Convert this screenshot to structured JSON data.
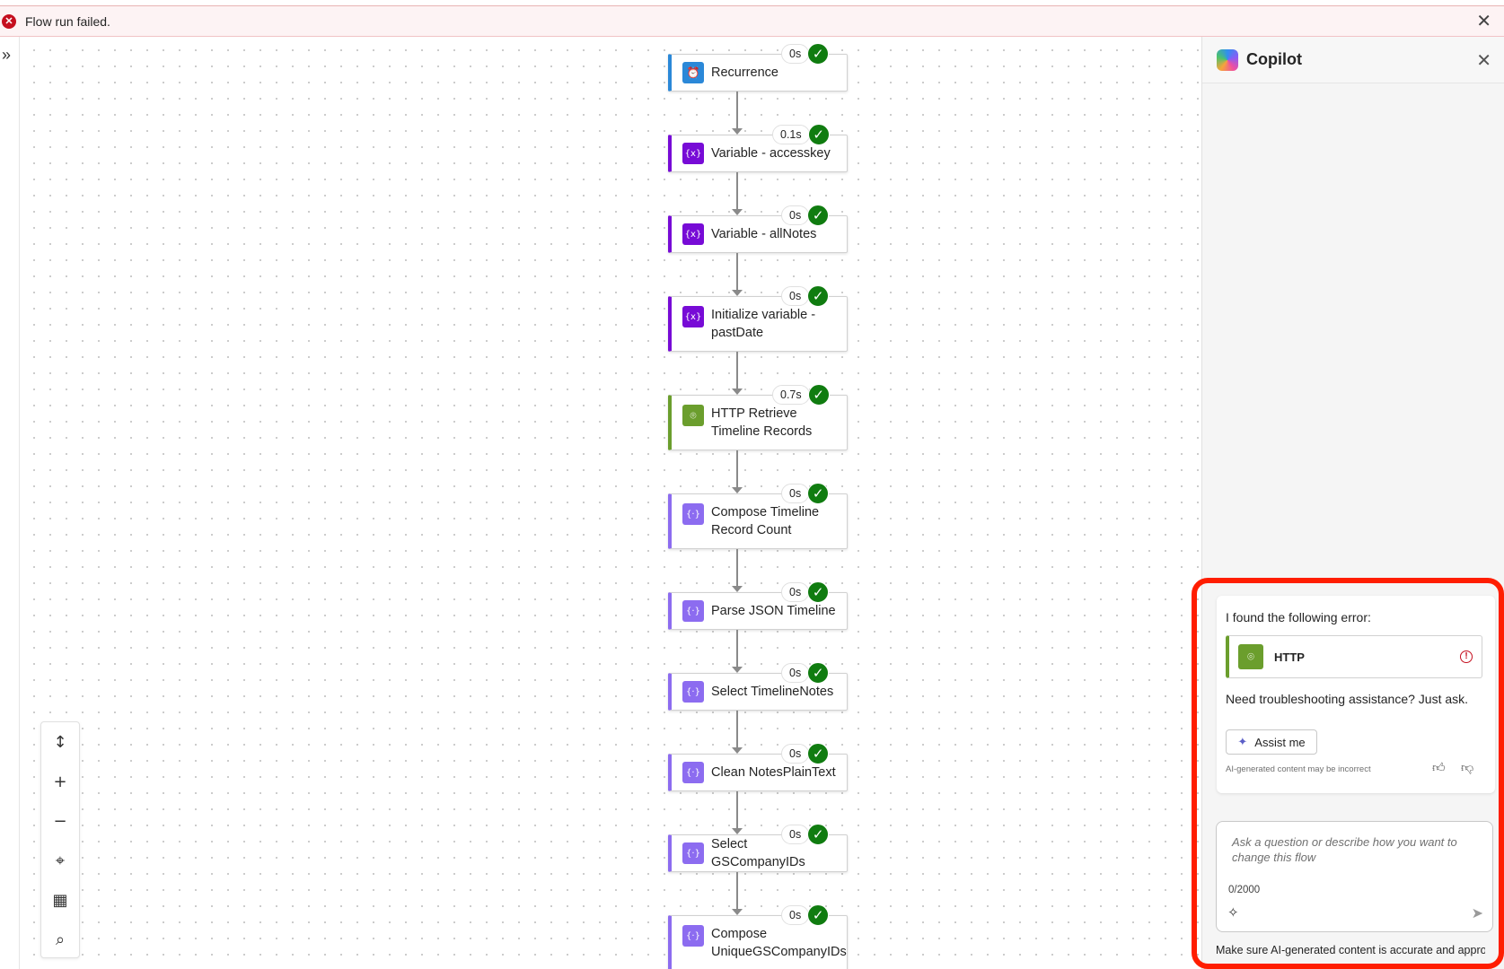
{
  "banner": {
    "message": "Flow run failed.",
    "close": "✕",
    "error_icon": "✕"
  },
  "leftrail": {
    "expand_icon": "»"
  },
  "flow": {
    "steps": [
      {
        "label": "Recurrence",
        "duration": "0s",
        "icon": "alarm-icon",
        "color": "#2b88d8"
      },
      {
        "label": "Variable - accesskey",
        "duration": "0.1s",
        "icon": "variable-icon",
        "color": "#770bd6"
      },
      {
        "label": "Variable - allNotes",
        "duration": "0s",
        "icon": "variable-icon",
        "color": "#770bd6"
      },
      {
        "label": "Initialize variable - pastDate",
        "duration": "0s",
        "icon": "variable-icon",
        "color": "#770bd6"
      },
      {
        "label": "HTTP Retrieve Timeline Records",
        "duration": "0.7s",
        "icon": "http-icon",
        "color": "#6b9e2d"
      },
      {
        "label": "Compose Timeline Record Count",
        "duration": "0s",
        "icon": "compose-icon",
        "color": "#8c6cf0"
      },
      {
        "label": "Parse JSON Timeline",
        "duration": "0s",
        "icon": "compose-icon",
        "color": "#8c6cf0"
      },
      {
        "label": "Select TimelineNotes",
        "duration": "0s",
        "icon": "compose-icon",
        "color": "#8c6cf0"
      },
      {
        "label": "Clean NotesPlainText",
        "duration": "0s",
        "icon": "compose-icon",
        "color": "#8c6cf0"
      },
      {
        "label": "Select GSCompanyIDs",
        "duration": "0s",
        "icon": "compose-icon",
        "color": "#8c6cf0"
      },
      {
        "label": "Compose UniqueGSCompanyIDs",
        "duration": "0s",
        "icon": "compose-icon",
        "color": "#8c6cf0"
      }
    ]
  },
  "copilot": {
    "title": "Copilot",
    "close": "✕",
    "message": {
      "intro": "I found the following error:",
      "action_label": "HTTP",
      "prompt": "Need troubleshooting assistance? Just ask.",
      "assist_label": "Assist me",
      "disclaimer": "AI-generated content may be incorrect"
    },
    "input": {
      "placeholder": "Ask a question or describe how you want to change this flow",
      "counter": "0/2000"
    },
    "footnote": "Make sure AI-generated content is accurate and appropriate information"
  }
}
